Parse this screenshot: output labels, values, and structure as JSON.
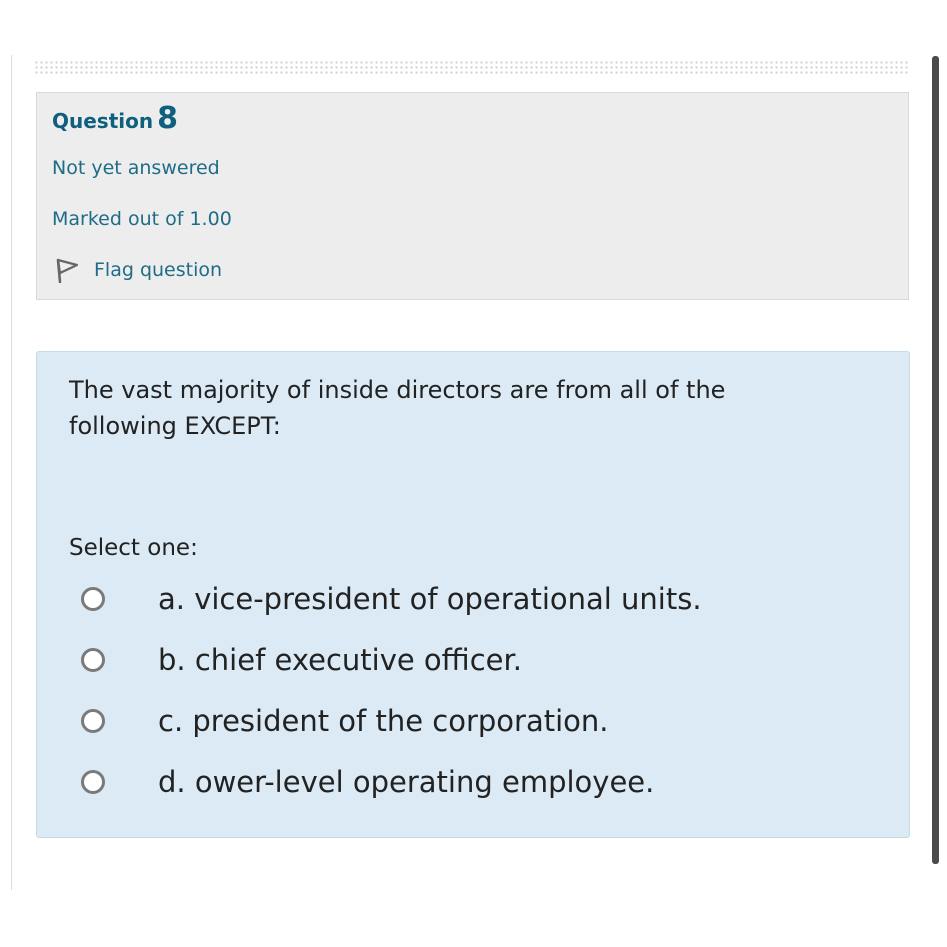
{
  "question_info": {
    "label": "Question",
    "number": "8",
    "state": "Not yet answered",
    "marks": "Marked out of 1.00",
    "flag_label": "Flag question",
    "flag_icon": "flag-outline-icon"
  },
  "question": {
    "text": "The vast majority of inside directors are from all of the\nfollowing EXCEPT:",
    "prompt": "Select one:",
    "options": [
      {
        "label": "a. vice-president of operational units.",
        "selected": false
      },
      {
        "label": "b. chief executive officer.",
        "selected": false
      },
      {
        "label": "c. president of the corporation.",
        "selected": false
      },
      {
        "label": "d. ower-level operating employee.",
        "selected": false
      }
    ]
  },
  "colors": {
    "info_background": "#ededed",
    "content_background": "#dbeaf4",
    "accent_text": "#0f5f7f",
    "body_text": "#222222"
  }
}
